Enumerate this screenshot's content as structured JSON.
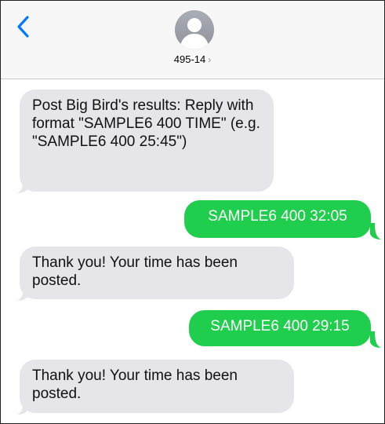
{
  "header": {
    "contact_name": "495-14",
    "contact_chevron": "›",
    "back_icon": "chevron-left-icon",
    "avatar_icon": "person-silhouette-icon",
    "accent_color": "#007aff"
  },
  "messages": [
    {
      "direction": "incoming",
      "text": "Post Big Bird's results: Reply with format \"SAMPLE6 400 TIME\" (e.g. \"SAMPLE6 400 25:45\")"
    },
    {
      "direction": "outgoing",
      "text": "SAMPLE6 400 32:05"
    },
    {
      "direction": "incoming",
      "text": "Thank you! Your time has been posted."
    },
    {
      "direction": "outgoing",
      "text": "SAMPLE6 400 29:15"
    },
    {
      "direction": "incoming",
      "text": "Thank you! Your time has been posted."
    }
  ],
  "colors": {
    "incoming_bubble": "#e5e5ea",
    "outgoing_bubble": "#1fce4c",
    "header_background": "#f7f7f7"
  }
}
